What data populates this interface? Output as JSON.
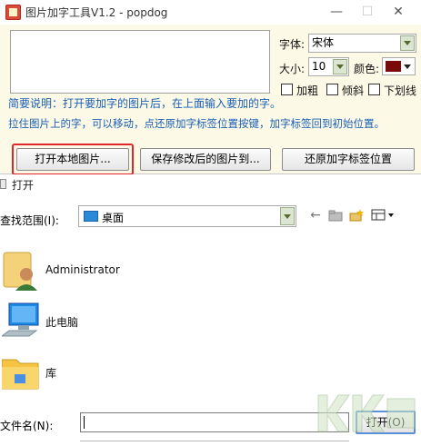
{
  "window1": {
    "title": "图片加字工具V1.2 - popdog",
    "controls": {
      "font_label": "字体:",
      "font_value": "宋体",
      "size_label": "大小:",
      "size_value": "10",
      "color_label": "颜色:",
      "color_value": "#7a0a0a"
    },
    "checkboxes": {
      "bold": "加粗",
      "italic": "倾斜",
      "underline": "下划线"
    },
    "hint1": "简要说明：打开要加字的图片后，在上面输入要加的字。",
    "hint2": "拉住图片上的字，可以移动，点还原加字标签位置按键，加字标签回到初始位置。",
    "buttons": {
      "open_local": "打开本地图片...",
      "save_modified": "保存修改后的图片到...",
      "reset_label": "还原加字标签位置"
    }
  },
  "dialog": {
    "title": "打开",
    "look_in_label": "查找范围(I):",
    "look_in_value": "桌面",
    "items": [
      {
        "name": "Administrator",
        "icon": "user-folder-icon"
      },
      {
        "name": "此电脑",
        "icon": "computer-icon"
      },
      {
        "name": "库",
        "icon": "library-folder-icon"
      }
    ],
    "filename_label": "文件名(N):",
    "filename_value": "",
    "open_button": "打开(O)"
  },
  "watermark_text": "KK下载 www.kkx.net",
  "colors": {
    "window_bg": "#fdf9e7",
    "hint_text": "#1a5fb4",
    "highlight_border": "#e0262a",
    "combo_arrow_bg": "#dbe5d2"
  }
}
